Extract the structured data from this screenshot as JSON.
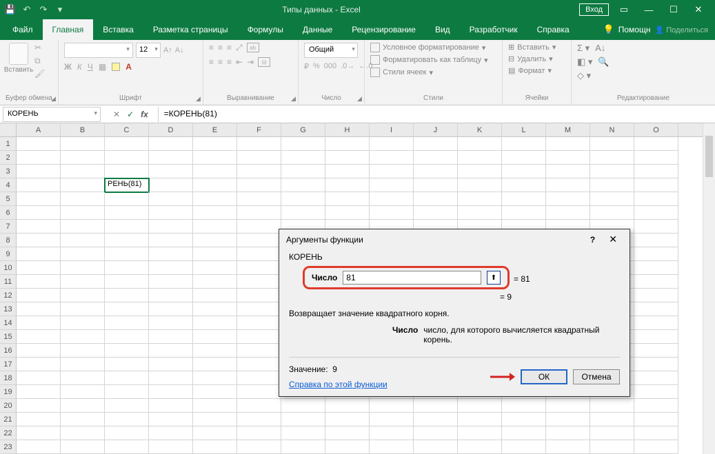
{
  "title": "Типы данных  -  Excel",
  "login_btn": "Вход",
  "tabs": {
    "file": "Файл",
    "home": "Главная",
    "insert": "Вставка",
    "layout": "Разметка страницы",
    "formulas": "Формулы",
    "data": "Данные",
    "review": "Рецензирование",
    "view": "Вид",
    "developer": "Разработчик",
    "help": "Справка",
    "tell": "Помощн",
    "share": "Поделиться"
  },
  "ribbon": {
    "clipboard": {
      "paste": "Вставить",
      "label": "Буфер обмена"
    },
    "font": {
      "size": "12",
      "label": "Шрифт"
    },
    "align": {
      "label": "Выравнивание"
    },
    "number": {
      "general": "Общий",
      "label": "Число"
    },
    "styles": {
      "cond": "Условное форматирование",
      "table": "Форматировать как таблицу",
      "cell": "Стили ячеек",
      "label": "Стили"
    },
    "cells": {
      "insert": "Вставить",
      "delete": "Удалить",
      "format": "Формат",
      "label": "Ячейки"
    },
    "editing": {
      "label": "Редактирование"
    }
  },
  "namebox": "КОРЕНЬ",
  "formula": "=КОРЕНЬ(81)",
  "active_cell_text": "РЕНЬ(81)",
  "columns": [
    "A",
    "B",
    "C",
    "D",
    "E",
    "F",
    "G",
    "H",
    "I",
    "J",
    "K",
    "L",
    "M",
    "N",
    "O"
  ],
  "rownums": [
    "1",
    "2",
    "3",
    "4",
    "5",
    "6",
    "7",
    "8",
    "9",
    "10",
    "11",
    "12",
    "13",
    "14",
    "15",
    "16",
    "17",
    "18",
    "19",
    "20",
    "21",
    "22",
    "23"
  ],
  "dialog": {
    "title": "Аргументы функции",
    "fn": "КОРЕНЬ",
    "arg_label": "Число",
    "arg_value": "81",
    "arg_eval": "= 81",
    "result_eq": "=  9",
    "desc": "Возвращает значение квадратного корня.",
    "arg_desc_label": "Число",
    "arg_desc_text": "число, для которого вычисляется квадратный корень.",
    "value_label": "Значение:",
    "value": "9",
    "help_link": "Справка по этой функции",
    "ok": "ОК",
    "cancel": "Отмена"
  }
}
